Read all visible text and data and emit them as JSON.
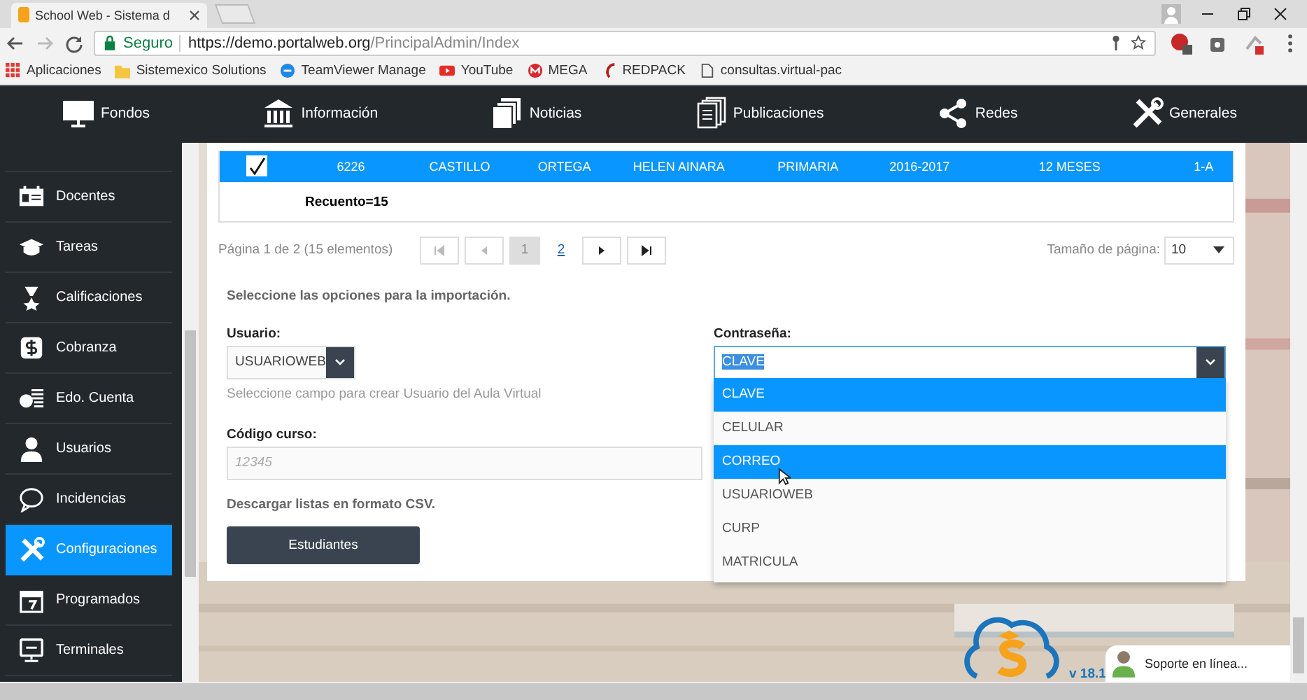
{
  "browser": {
    "tab_title": "School Web - Sistema d",
    "secure_label": "Seguro",
    "url_host": "https://demo.portalweb.org",
    "url_path": "/PrincipalAdmin/Index",
    "bookmarks": [
      "Aplicaciones",
      "Sistemexico Solutions",
      "TeamViewer Manage",
      "YouTube",
      "MEGA",
      "REDPACK",
      "consultas.virtual-pac"
    ]
  },
  "top_nav": [
    "Fondos",
    "Información",
    "Noticias",
    "Publicaciones",
    "Redes",
    "Generales"
  ],
  "sidebar": {
    "items": [
      {
        "label": "Docentes",
        "selected": false
      },
      {
        "label": "Tareas",
        "selected": false
      },
      {
        "label": "Calificaciones",
        "selected": false
      },
      {
        "label": "Cobranza",
        "selected": false
      },
      {
        "label": "Edo. Cuenta",
        "selected": false
      },
      {
        "label": "Usuarios",
        "selected": false
      },
      {
        "label": "Incidencias",
        "selected": false
      },
      {
        "label": "Configuraciones",
        "selected": true
      },
      {
        "label": "Programados",
        "selected": false
      },
      {
        "label": "Terminales",
        "selected": false
      }
    ]
  },
  "table": {
    "row": {
      "checked": true,
      "selected": true,
      "cells": [
        "6226",
        "CASTILLO",
        "ORTEGA",
        "HELEN AINARA",
        "PRIMARIA",
        "2016-2017",
        "12 MESES",
        "1-A"
      ]
    },
    "footer": "Recuento=15"
  },
  "pager": {
    "summary": "Página 1 de 2 (15 elementos)",
    "pages": [
      {
        "label": "1",
        "selected": true
      },
      {
        "label": "2",
        "selected": false
      }
    ],
    "page_size_label": "Tamaño de página:",
    "page_size_value": "10"
  },
  "form": {
    "intro": "Seleccione las opciones para la importación.",
    "usuario": {
      "label": "Usuario:",
      "value": "USUARIOWEB",
      "hint": "Seleccione campo para crear Usuario del Aula Virtual"
    },
    "contrasena": {
      "label": "Contraseña:",
      "value": "CLAVE",
      "expanded": true,
      "options": [
        {
          "label": "CLAVE",
          "selected": true,
          "hovered": false
        },
        {
          "label": "CELULAR",
          "selected": false,
          "hovered": false
        },
        {
          "label": "CORREO",
          "selected": false,
          "hovered": true
        },
        {
          "label": "USUARIOWEB",
          "selected": false,
          "hovered": false
        },
        {
          "label": "CURP",
          "selected": false,
          "hovered": false
        },
        {
          "label": "MATRICULA",
          "selected": false,
          "hovered": false
        }
      ]
    },
    "codigo": {
      "label": "Código curso:",
      "placeholder": "12345"
    },
    "download_label": "Descargar listas en formato CSV.",
    "button": "Estudiantes"
  },
  "footer": {
    "version": "v 18.1",
    "support": "Soporte en línea..."
  }
}
